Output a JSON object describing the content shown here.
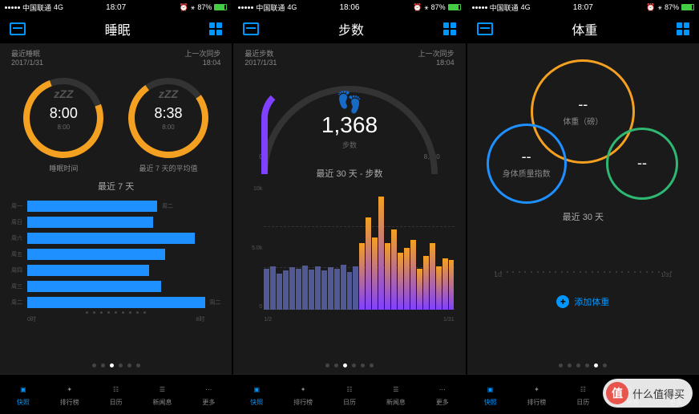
{
  "status": {
    "carrier": "中国联通",
    "network": "4G",
    "battery": "87%",
    "alarm": "⏰",
    "bt": "⚹"
  },
  "tabs": {
    "snapshot": "快照",
    "ranking": "排行榜",
    "calendar": "日历",
    "news": "新闻息",
    "more": "更多"
  },
  "s1": {
    "time": "18:07",
    "title": "睡眠",
    "sub_left_1": "最近睡眠",
    "sub_left_2": "2017/1/31",
    "sub_right_1": "上一次同步",
    "sub_right_2": "18:04",
    "c1_val": "8:00",
    "c1_sub": "8:00",
    "c1_label": "睡眠时间",
    "c2_val": "8:38",
    "c2_sub": "8:00",
    "c2_label": "最近 7 天的平均值",
    "section": "最近 7 天",
    "axis_left": "0时",
    "axis_right": "8时",
    "days": [
      "周一",
      "周日",
      "周六",
      "周五",
      "周四",
      "周三",
      "周二"
    ],
    "days_r": [
      "周二",
      "",
      "",
      "",
      "",
      "",
      "周二"
    ],
    "pager_active": 2
  },
  "s2": {
    "time": "18:06",
    "title": "步数",
    "sub_left_1": "最近步数",
    "sub_left_2": "2017/1/31",
    "sub_right_1": "上一次同步",
    "sub_right_2": "18:04",
    "arc_val": "1,368",
    "arc_label": "步数",
    "arc_start": "0",
    "arc_end": "8,330",
    "section": "最近 30 天 - 步数",
    "y_labels": [
      "10k",
      "5.0k",
      "0"
    ],
    "x_left": "1/2",
    "x_right": "1/31",
    "pager_active": 2
  },
  "s3": {
    "time": "18:07",
    "title": "体重",
    "c1_val": "--",
    "c1_label": "体重（磅）",
    "c2_val": "--",
    "c2_label": "身体质量指数",
    "c3_val": "--",
    "c3_label": "",
    "section": "最近 30 天",
    "x_left": "1/2",
    "x_right": "1/31",
    "add_label": "添加体重",
    "pager_active": 4
  },
  "watermark": "什么值得买",
  "chart_data": [
    {
      "type": "bar",
      "orientation": "horizontal",
      "title": "最近 7 天",
      "ylabel": "",
      "xlabel": "时",
      "xlim": [
        0,
        8
      ],
      "categories": [
        "周一",
        "周日",
        "周六",
        "周五",
        "周四",
        "周三",
        "周二"
      ],
      "values": [
        6.8,
        6.5,
        8.8,
        7.2,
        6.3,
        7.0,
        9.5
      ]
    },
    {
      "type": "bar",
      "title": "最近 30 天 - 步数",
      "ylabel": "",
      "ylim": [
        0,
        12000
      ],
      "xlabel": "",
      "xlim": [
        "1/2",
        "1/31"
      ],
      "values": [
        4000,
        4200,
        3500,
        3800,
        4100,
        4000,
        4300,
        3900,
        4200,
        3800,
        4100,
        4000,
        4400,
        3700,
        4200,
        6500,
        9000,
        7000,
        11000,
        6500,
        7800,
        5500,
        6000,
        6800,
        4000,
        5200,
        6500,
        4200,
        5000,
        4800
      ]
    }
  ]
}
